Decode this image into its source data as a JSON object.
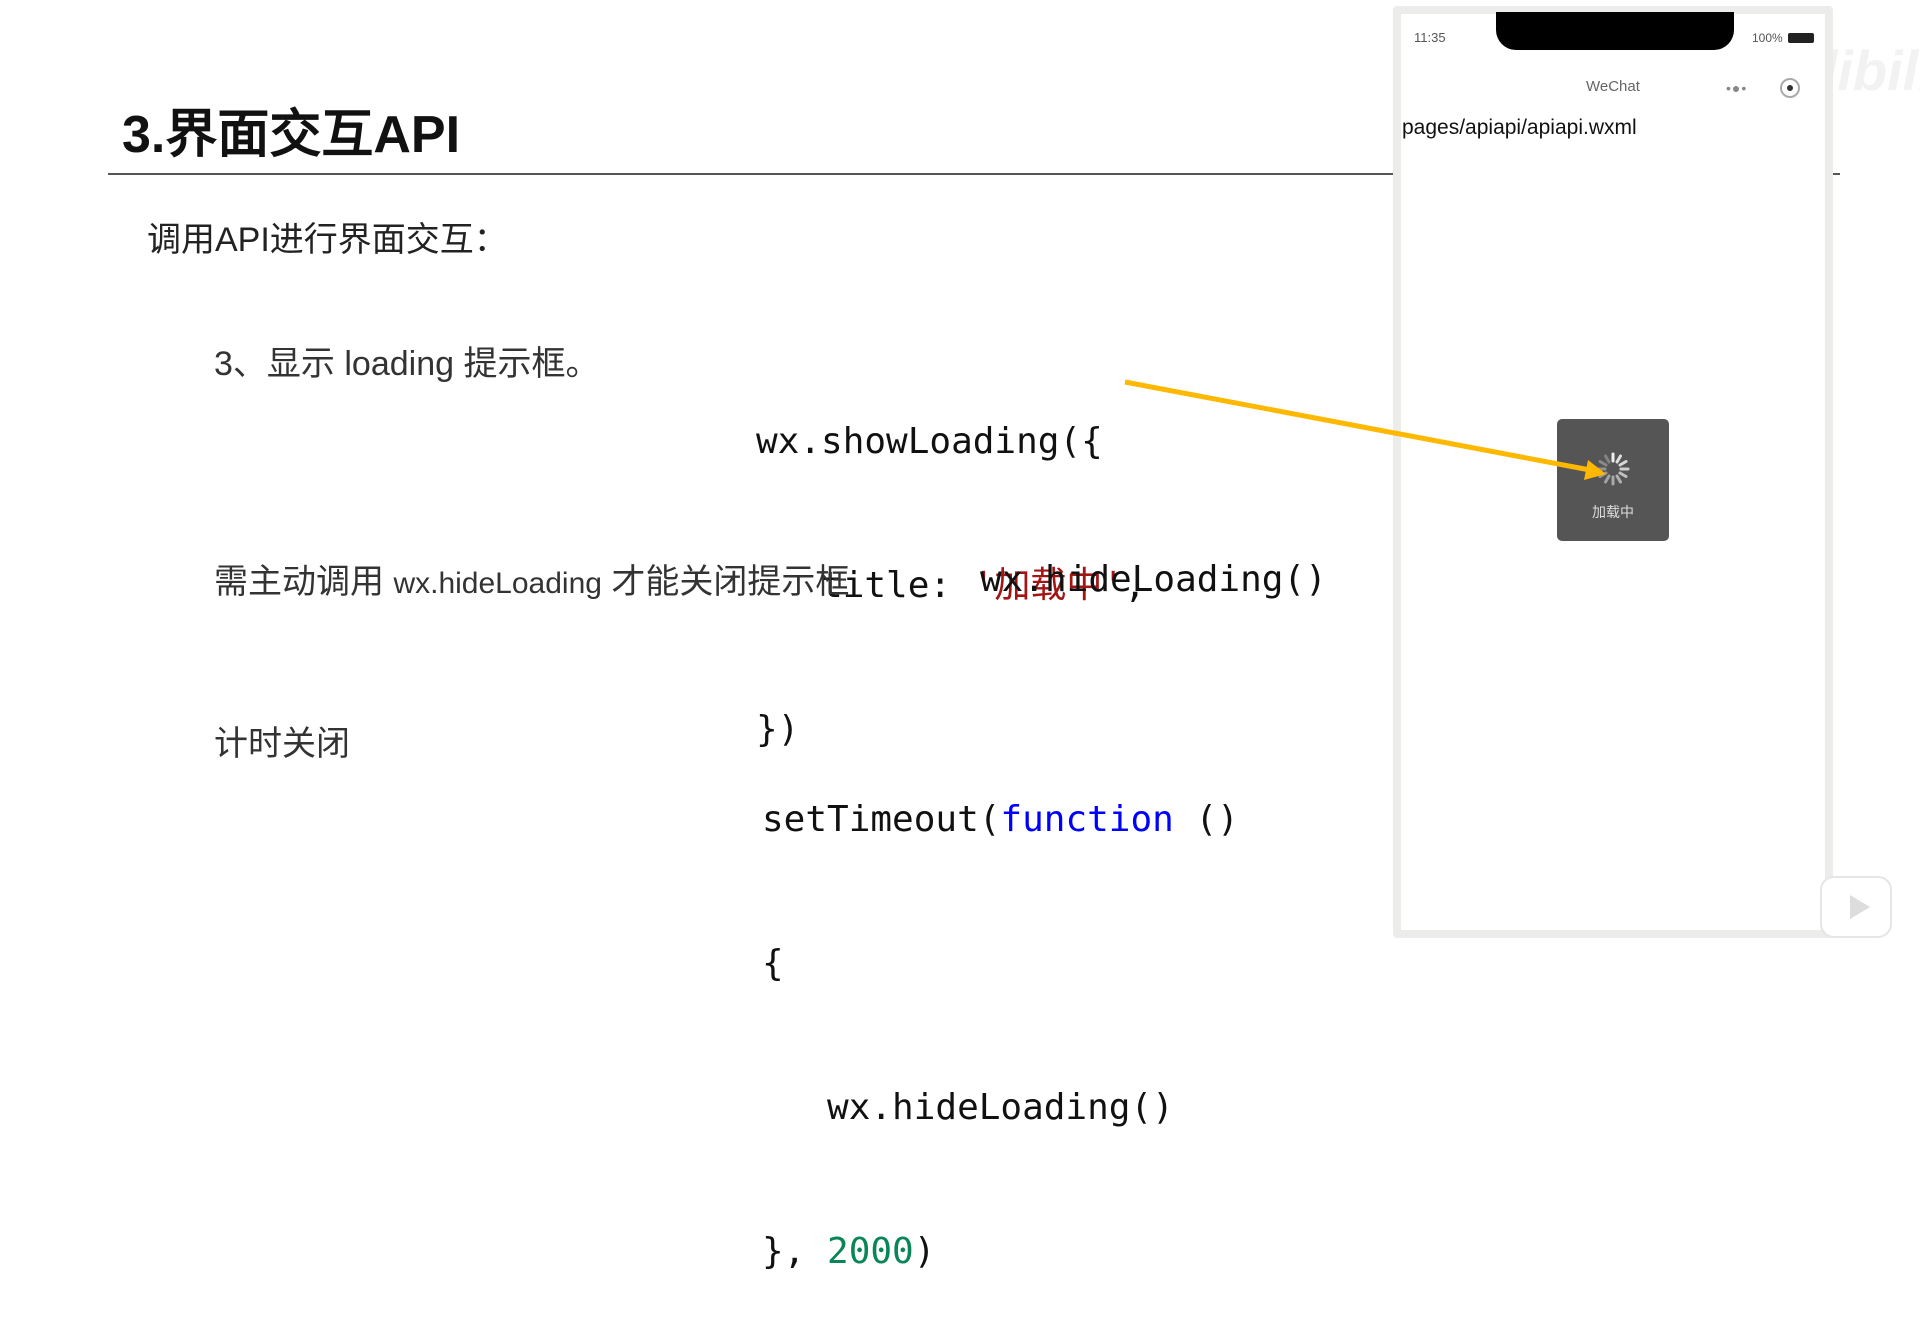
{
  "slide": {
    "title": "3.界面交互API",
    "intro": "调用API进行界面交互：",
    "item1_label": "3、显示 loading 提示框。",
    "code1": {
      "line1": "wx.showLoading({",
      "line2_key": "   title: ",
      "line2_str": "'加载中'",
      "line2_end": ",",
      "line3": "})"
    },
    "item2_label_a": "需主动调用 ",
    "item2_label_code": "wx.hideLoading",
    "item2_label_b": " 才能关闭提示框",
    "code2": "wx.hideLoading()",
    "item3_label": "计时关闭",
    "code3": {
      "l1a": "setTimeout(",
      "l1kw": "function",
      "l1b": " ()",
      "l2": "{",
      "l3": "   wx.hideLoading()",
      "l4a": "}, ",
      "l4num": "2000",
      "l4b": ")"
    }
  },
  "phone": {
    "time": "11:35",
    "battery": "100%",
    "nav_title": "WeChat",
    "nav_dots": "•●•",
    "page_path": "pages/apiapi/apiapi.wxml",
    "toast_text": "加载中"
  },
  "watermark": "bilibili",
  "colors": {
    "arrow": "#ffb800",
    "string": "#a31515",
    "keyword": "#0000ff",
    "number": "#098658",
    "toast_bg": "#555555"
  },
  "icons": {
    "spinner": "loading-spinner-icon",
    "play": "play-icon",
    "battery": "battery-icon"
  }
}
